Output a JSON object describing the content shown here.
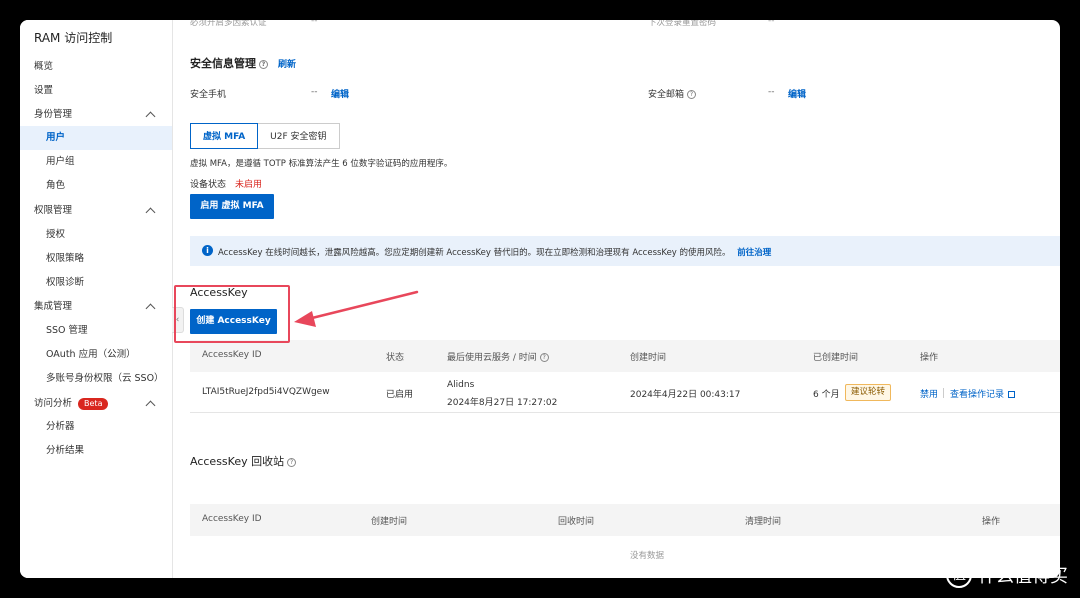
{
  "sidebar": {
    "title": "RAM 访问控制",
    "items": [
      {
        "label": "概览"
      },
      {
        "label": "设置"
      },
      {
        "label": "身份管理"
      },
      {
        "label": "用户"
      },
      {
        "label": "用户组"
      },
      {
        "label": "角色"
      },
      {
        "label": "权限管理"
      },
      {
        "label": "授权"
      },
      {
        "label": "权限策略"
      },
      {
        "label": "权限诊断"
      },
      {
        "label": "集成管理"
      },
      {
        "label": "SSO 管理"
      },
      {
        "label": "OAuth 应用（公测）"
      },
      {
        "label": "多账号身份权限（云 SSO）"
      },
      {
        "label": "访问分析"
      },
      {
        "label": "分析器"
      },
      {
        "label": "分析结果"
      }
    ],
    "beta_label": "Beta",
    "collapse_glyph": "‹"
  },
  "top_cut": {
    "left_label": "必须开启多因素认证",
    "left_value": "--",
    "right_label": "下次登录重置密码",
    "right_value": "--"
  },
  "security_info": {
    "title": "安全信息管理",
    "help": "?",
    "refresh": "刷新",
    "phone_label": "安全手机",
    "phone_value": "--",
    "phone_edit": "编辑",
    "email_label": "安全邮箱",
    "email_value": "--",
    "email_edit": "编辑"
  },
  "mfa": {
    "tabs": [
      "虚拟 MFA",
      "U2F 安全密钥"
    ],
    "description": "虚拟 MFA，是遵循 TOTP 标准算法产生 6 位数字验证码的应用程序。",
    "status_label": "设备状态",
    "status_value": "未启用",
    "enable_button": "启用 虚拟 MFA"
  },
  "notice": {
    "icon": "i",
    "text": "AccessKey 在线时间越长，泄露风险越高。您应定期创建新 AccessKey 替代旧的。现在立即检测和治理现有 AccessKey 的使用风险。",
    "link": "前往治理"
  },
  "accesskey": {
    "title": "AccessKey",
    "create_button": "创建 AccessKey",
    "columns": [
      "AccessKey ID",
      "状态",
      "最后使用云服务 / 时间",
      "创建时间",
      "已创建时间",
      "操作"
    ],
    "rows": [
      {
        "id": "LTAI5tRueJ2fpd5i4VQZWgew",
        "status": "已启用",
        "service": "Alidns",
        "last_used": "2024年8月27日 17:27:02",
        "created": "2024年4月22日 00:43:17",
        "age": "6 个月",
        "age_tag": "建议轮转",
        "action_disable": "禁用",
        "action_log": "查看操作记录"
      }
    ]
  },
  "recycle": {
    "title": "AccessKey 回收站",
    "columns": [
      "AccessKey ID",
      "创建时间",
      "回收时间",
      "清理时间",
      "操作"
    ],
    "empty": "没有数据"
  },
  "watermark": {
    "glyph": "值",
    "text": "什么值得买"
  },
  "colors": {
    "primary": "#0064c8",
    "danger": "#d9271f",
    "highlight": "#e8475b"
  }
}
